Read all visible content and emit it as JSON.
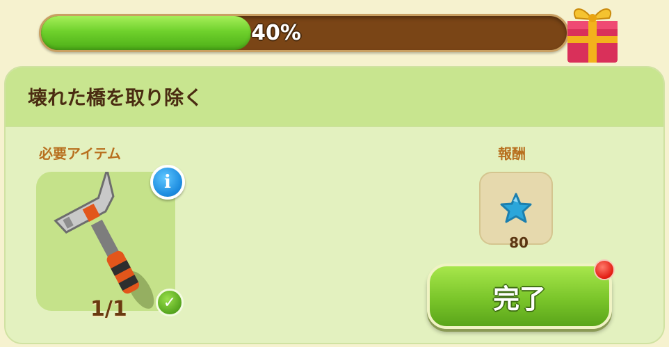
{
  "progress": {
    "percent": 40,
    "label": "40%"
  },
  "panel": {
    "title": "壊れた橋を取り除く",
    "required_label": "必要アイテム",
    "reward_label": "報酬",
    "item": {
      "icon": "hammer-icon",
      "count": "1/1",
      "status_icon": "checkmark-icon",
      "info_icon": "info-icon"
    },
    "reward": {
      "icon": "blue-star-icon",
      "amount": "80"
    },
    "complete_button": "完了"
  },
  "colors": {
    "progress_fill": "#6fd12c",
    "progress_track": "#7a4516",
    "panel_bg": "#e3f1bf",
    "header_bg": "#c8e58f",
    "accent_label": "#b8701f",
    "button_green": "#7ac52a"
  }
}
